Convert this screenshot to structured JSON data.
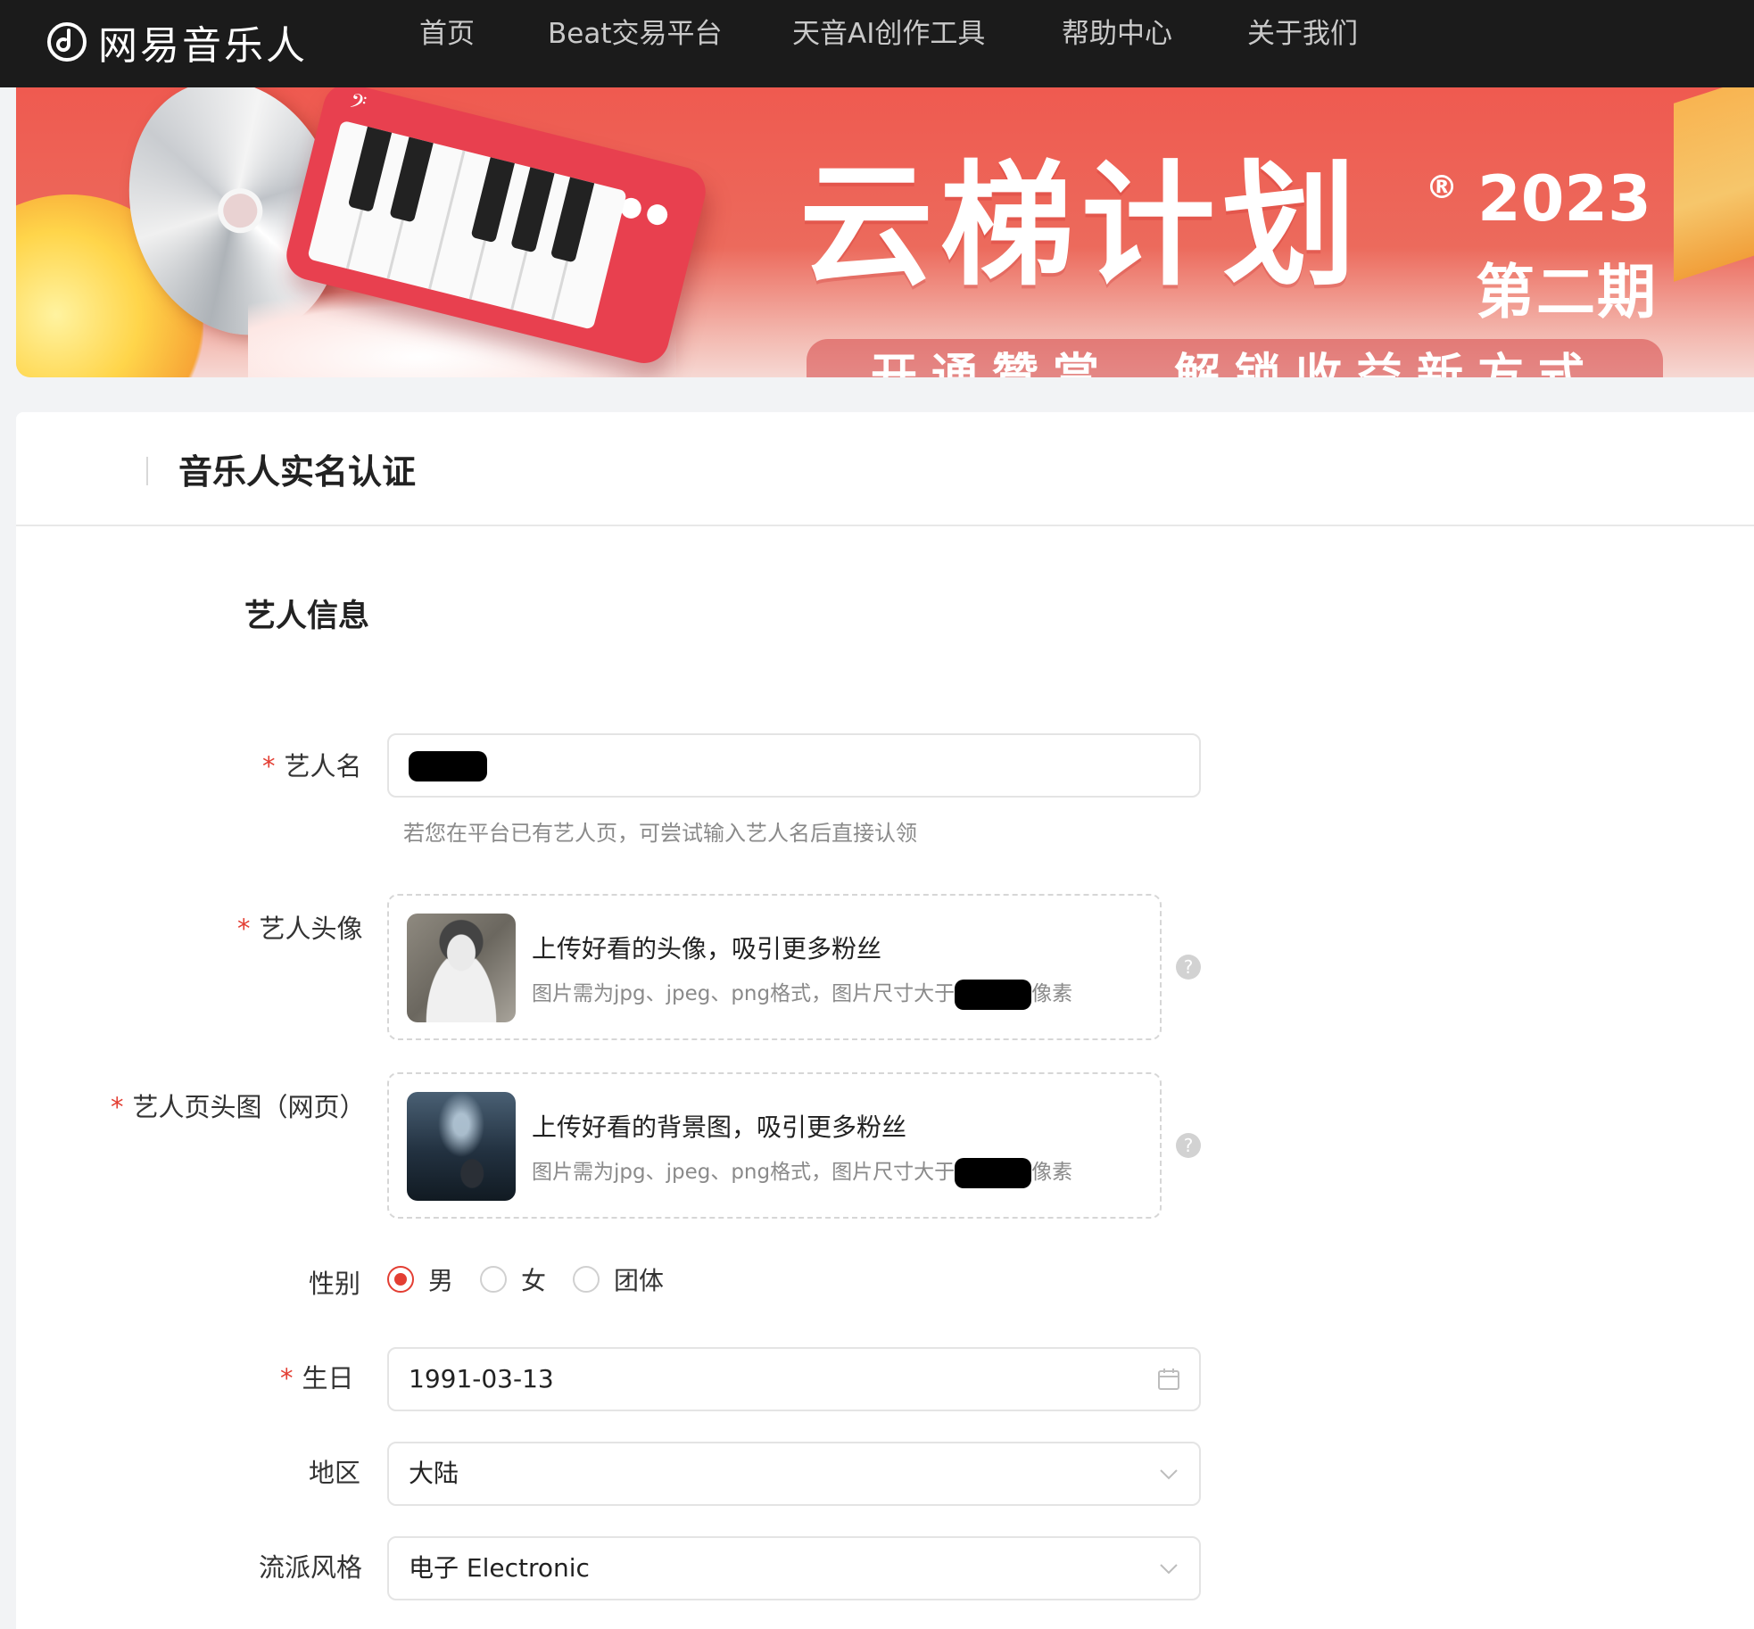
{
  "nav": {
    "brand": "网易音乐人",
    "items": [
      "首页",
      "Beat交易平台",
      "天音AI创作工具",
      "帮助中心",
      "关于我们"
    ]
  },
  "banner": {
    "title": "云梯计划",
    "reg_mark": "®",
    "year": "2023",
    "phase": "第二期",
    "slogan": "开通赞赏，解锁收益新方式"
  },
  "page": {
    "title": "音乐人实名认证"
  },
  "section": {
    "title": "艺人信息"
  },
  "form": {
    "artist_name": {
      "label": "艺人名",
      "required_mark": "*",
      "hint": "若您在平台已有艺人页，可尝试输入艺人名后直接认领"
    },
    "avatar": {
      "label": "艺人头像",
      "required_mark": "*",
      "title": "上传好看的头像，吸引更多粉丝",
      "sub_prefix": "图片需为jpg、jpeg、png格式，图片尺寸大于",
      "sub_suffix": "像素",
      "help": "?"
    },
    "header_image": {
      "label": "艺人页头图（网页）",
      "required_mark": "*",
      "title": "上传好看的背景图，吸引更多粉丝",
      "sub_prefix": "图片需为jpg、jpeg、png格式，图片尺寸大于",
      "sub_suffix": "像素",
      "help": "?"
    },
    "gender": {
      "label": "性别",
      "options": [
        "男",
        "女",
        "团体"
      ],
      "selected": "男"
    },
    "birthday": {
      "label": "生日",
      "required_mark": "*",
      "value": "1991-03-13"
    },
    "region": {
      "label": "地区",
      "value": "大陆"
    },
    "genre": {
      "label": "流派风格",
      "value": "电子 Electronic"
    }
  },
  "colors": {
    "accent": "#e33e33",
    "nav_bg": "#1b1b1b",
    "banner_red": "#ef5a50"
  },
  "icons": [
    "logo-note-icon",
    "help-icon",
    "calendar-icon",
    "chevron-down-icon"
  ]
}
